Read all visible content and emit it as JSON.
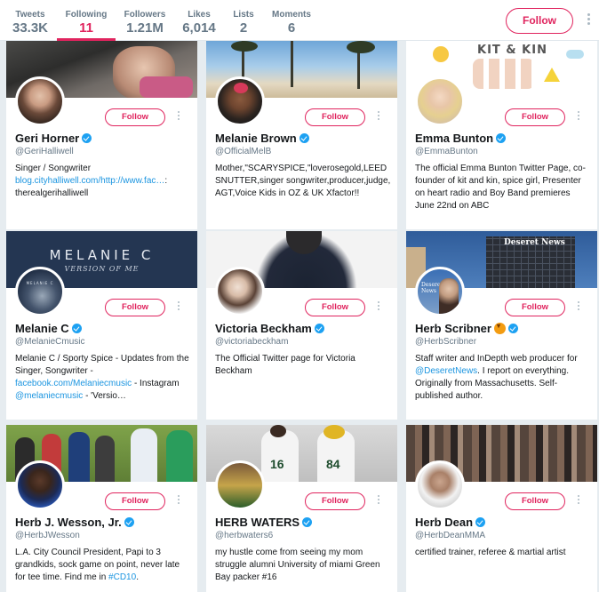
{
  "profile_nav": {
    "tweets": {
      "label": "Tweets",
      "value": "33.3K"
    },
    "following": {
      "label": "Following",
      "value": "11"
    },
    "followers": {
      "label": "Followers",
      "value": "1.21M"
    },
    "likes": {
      "label": "Likes",
      "value": "6,014"
    },
    "lists": {
      "label": "Lists",
      "value": "2"
    },
    "moments": {
      "label": "Moments",
      "value": "6"
    },
    "follow_label": "Follow"
  },
  "cards": [
    {
      "name": "Geri Horner",
      "handle": "@GeriHalliwell",
      "verified": true,
      "bio_1": "Singer / Songwriter",
      "bio_link": "blog.cityhalliwell.com/http://www.fac…",
      "bio_2": ": therealgerihalliwell",
      "follow": "Follow"
    },
    {
      "name": "Melanie Brown",
      "handle": "@OfficialMelB",
      "verified": true,
      "bio": "Mother,\"SCARYSPICE,\"loverosegold,LEEDSNUTTER,singer songwriter,producer,judge, AGT,Voice Kids in OZ & UK Xfactor!!",
      "follow": "Follow"
    },
    {
      "name": "Emma Bunton",
      "handle": "@EmmaBunton",
      "verified": true,
      "banner_text": "KIT & KIN",
      "bio": "The official Emma Bunton Twitter Page, co-founder of kit and kin, spice girl, Presenter on heart radio and Boy Band premieres June 22nd on ABC",
      "follow": "Follow"
    },
    {
      "name": "Melanie C",
      "handle": "@MelanieCmusic",
      "verified": true,
      "banner_title": "MELANIE C",
      "banner_subtitle": "VERSION OF ME",
      "avatar_text": "MELANIE C",
      "bio_1": "Melanie C / Sporty Spice - Updates from the Singer, Songwriter -",
      "bio_link1": "facebook.com/Melaniecmusic",
      "bio_2": " - Instagram ",
      "bio_link2": "@melaniecmusic",
      "bio_3": " - 'Versio…",
      "follow": "Follow"
    },
    {
      "name": "Victoria Beckham",
      "handle": "@victoriabeckham",
      "verified": true,
      "bio": "The Official Twitter page for Victoria Beckham",
      "follow": "Follow"
    },
    {
      "name": "Herb Scribner",
      "handle": "@HerbScribner",
      "verified": true,
      "banner_text": "Deseret News",
      "avatar_text": "Deseret News",
      "bio_1": "Staff writer and InDepth web producer for ",
      "bio_link": "@DeseretNews",
      "bio_2": ". I report on everything. Originally from Massachusetts. Self-published author.",
      "follow": "Follow"
    },
    {
      "name": "Herb J. Wesson, Jr.",
      "handle": "@HerbJWesson",
      "verified": true,
      "bio_1": "L.A. City Council President, Papi to 3 grandkids, sock game on point, never late for tee time. Find me in ",
      "bio_link": "#CD10",
      "bio_2": ".",
      "follow": "Follow"
    },
    {
      "name": "HERB WATERS",
      "handle": "@herbwaters6",
      "verified": true,
      "banner_nums": [
        "16",
        "84"
      ],
      "bio": "my hustle come from seeing my mom struggle alumni University of miami Green Bay packer #16",
      "follow": "Follow"
    },
    {
      "name": "Herb Dean",
      "handle": "@HerbDeanMMA",
      "verified": true,
      "bio": "certified trainer, referee & martial artist",
      "follow": "Follow"
    }
  ],
  "colors": {
    "accent": "#e0245e",
    "link": "#1b95e0",
    "verified": "#1da1f2",
    "background": "#e6ecf0"
  }
}
